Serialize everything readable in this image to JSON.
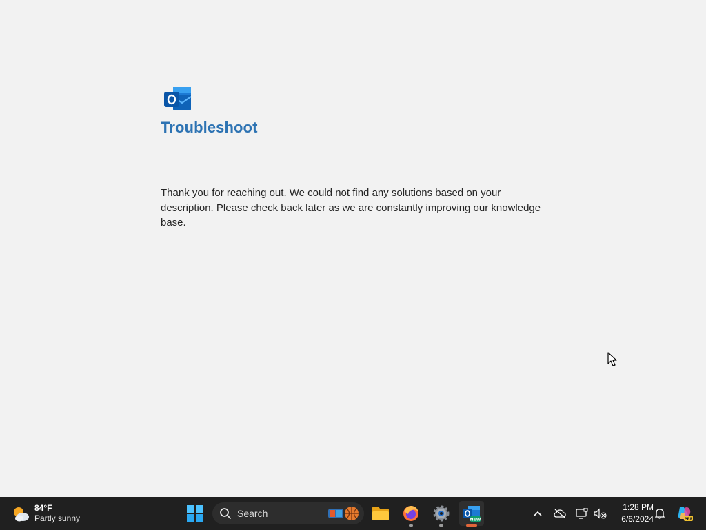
{
  "app": {
    "logo_icon": "outlook-logo-icon",
    "title": "Troubleshoot",
    "message": "Thank you for reaching out. We could not find any solutions based on your description. Please check back later as we are constantly improving our knowledge base."
  },
  "taskbar": {
    "weather": {
      "temperature": "84°F",
      "condition": "Partly sunny",
      "icon": "partly-sunny-icon"
    },
    "start_icon": "windows-start-icon",
    "search": {
      "label": "Search",
      "icon": "search-icon"
    },
    "pinned_apps": [
      {
        "name": "File Explorer",
        "icon": "folder-icon"
      },
      {
        "name": "Firefox",
        "icon": "firefox-icon"
      },
      {
        "name": "Settings",
        "icon": "gear-icon"
      },
      {
        "name": "Outlook (new)",
        "icon": "outlook-new-icon",
        "active": true
      }
    ],
    "tray": {
      "icons": [
        "chevron-up-icon",
        "onedrive-offline-icon",
        "display-icon",
        "network-volume-muted-icon",
        "notifications-bell-icon",
        "copilot-icon"
      ],
      "time": "1:28 PM",
      "date": "6/6/2024"
    }
  },
  "colors": {
    "title": "#2d73b3",
    "background": "#f2f2f2",
    "taskbar": "#202020"
  }
}
